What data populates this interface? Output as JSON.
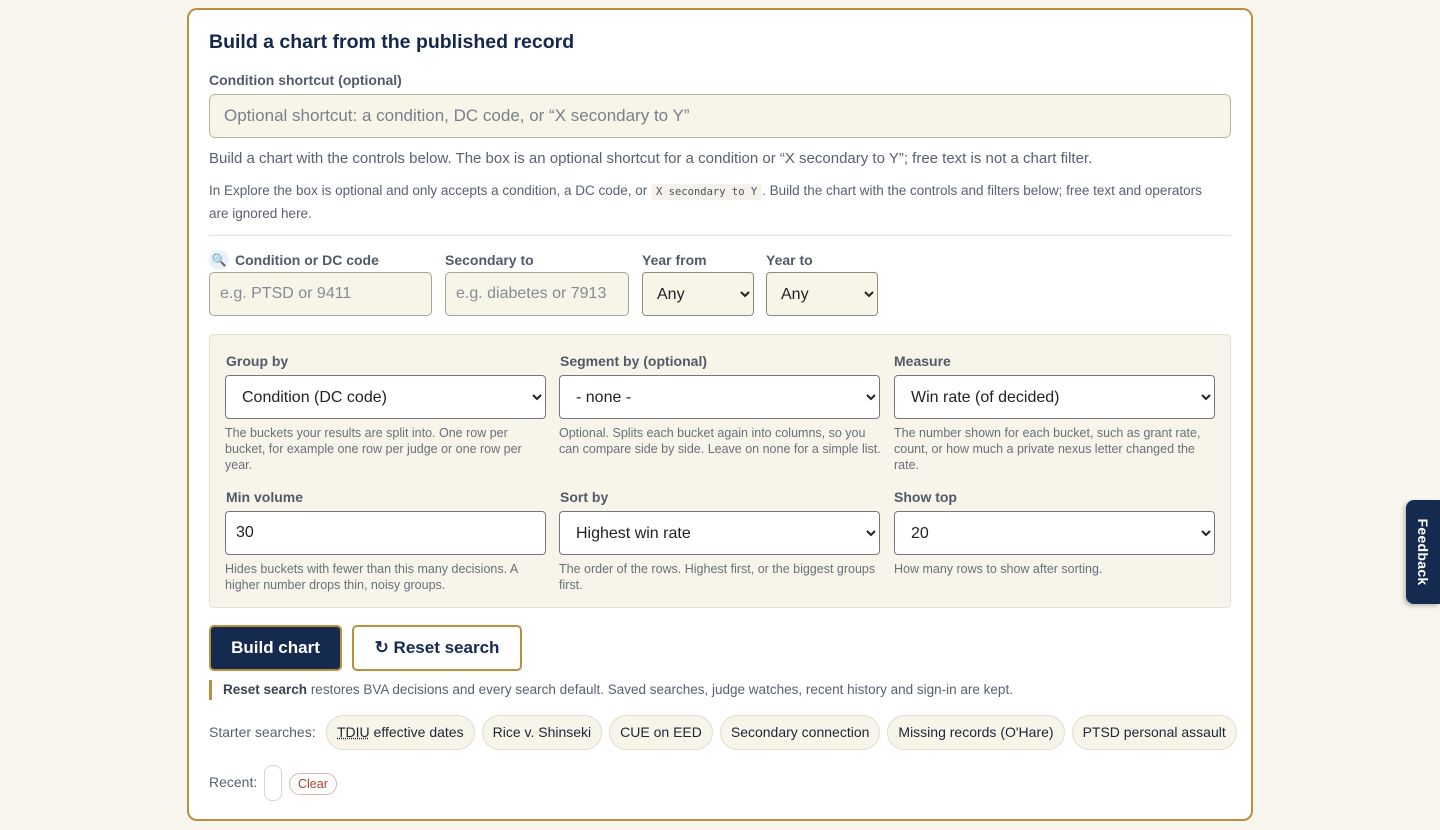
{
  "card": {
    "title": "Build a chart from the published record",
    "shortcut": {
      "label": "Condition shortcut (optional)",
      "placeholder": "Optional shortcut: a condition, DC code, or “X secondary to Y”",
      "value": ""
    },
    "help_line1": "Build a chart with the controls below. The box is an optional shortcut for a condition or “X secondary to Y”; free text is not a chart filter.",
    "help_line2_a": "In Explore the box is optional and only accepts a condition, a DC code, or ",
    "help_line2_code": "X secondary to Y",
    "help_line2_b": ". Build the chart with the controls and filters below; free text and operators are ignored here."
  },
  "filters": {
    "condition": {
      "icon": "search-icon",
      "label": "Condition or DC code",
      "placeholder": "e.g. PTSD or 9411",
      "value": ""
    },
    "secondary": {
      "label": "Secondary to",
      "placeholder": "e.g. diabetes or 7913",
      "value": ""
    },
    "year_from": {
      "label": "Year from",
      "selected": "Any"
    },
    "year_to": {
      "label": "Year to",
      "selected": "Any"
    }
  },
  "chart_options": {
    "group_by": {
      "label": "Group by",
      "selected": "Condition (DC code)",
      "hint": "The buckets your results are split into. One row per bucket, for example one row per judge or one row per year."
    },
    "segment_by": {
      "label": "Segment by (optional)",
      "selected": "- none -",
      "hint": "Optional. Splits each bucket again into columns, so you can compare side by side. Leave on none for a simple list."
    },
    "measure": {
      "label": "Measure",
      "selected": "Win rate (of decided)",
      "hint": "The number shown for each bucket, such as grant rate, count, or how much a private nexus letter changed the rate."
    },
    "min_volume": {
      "label": "Min volume",
      "value": "30",
      "hint": "Hides buckets with fewer than this many decisions. A higher number drops thin, noisy groups."
    },
    "sort_by": {
      "label": "Sort by",
      "selected": "Highest win rate",
      "hint": "The order of the rows. Highest first, or the biggest groups first."
    },
    "show_top": {
      "label": "Show top",
      "selected": "20",
      "hint": "How many rows to show after sorting."
    }
  },
  "actions": {
    "build_label": "Build chart",
    "reset_label": "↻ Reset search",
    "note_bold": "Reset search",
    "note_rest": " restores BVA decisions and every search default. Saved searches, judge watches, recent history and sign-in are kept."
  },
  "starters": {
    "label": "Starter searches:",
    "chip_tdiu_abbr": "TDIU",
    "chip_tdiu_rest": " effective dates",
    "chips": [
      "Rice v. Shinseki",
      "CUE on EED",
      "Secondary connection",
      "Missing records (O'Hare)",
      "PTSD personal assault"
    ]
  },
  "recent": {
    "label": "Recent:",
    "clear_label": "Clear"
  },
  "feedback": {
    "label": "Feedback"
  },
  "colors": {
    "navy": "#142a4f",
    "gold": "#b8923a",
    "background": "#f8f6ec"
  }
}
